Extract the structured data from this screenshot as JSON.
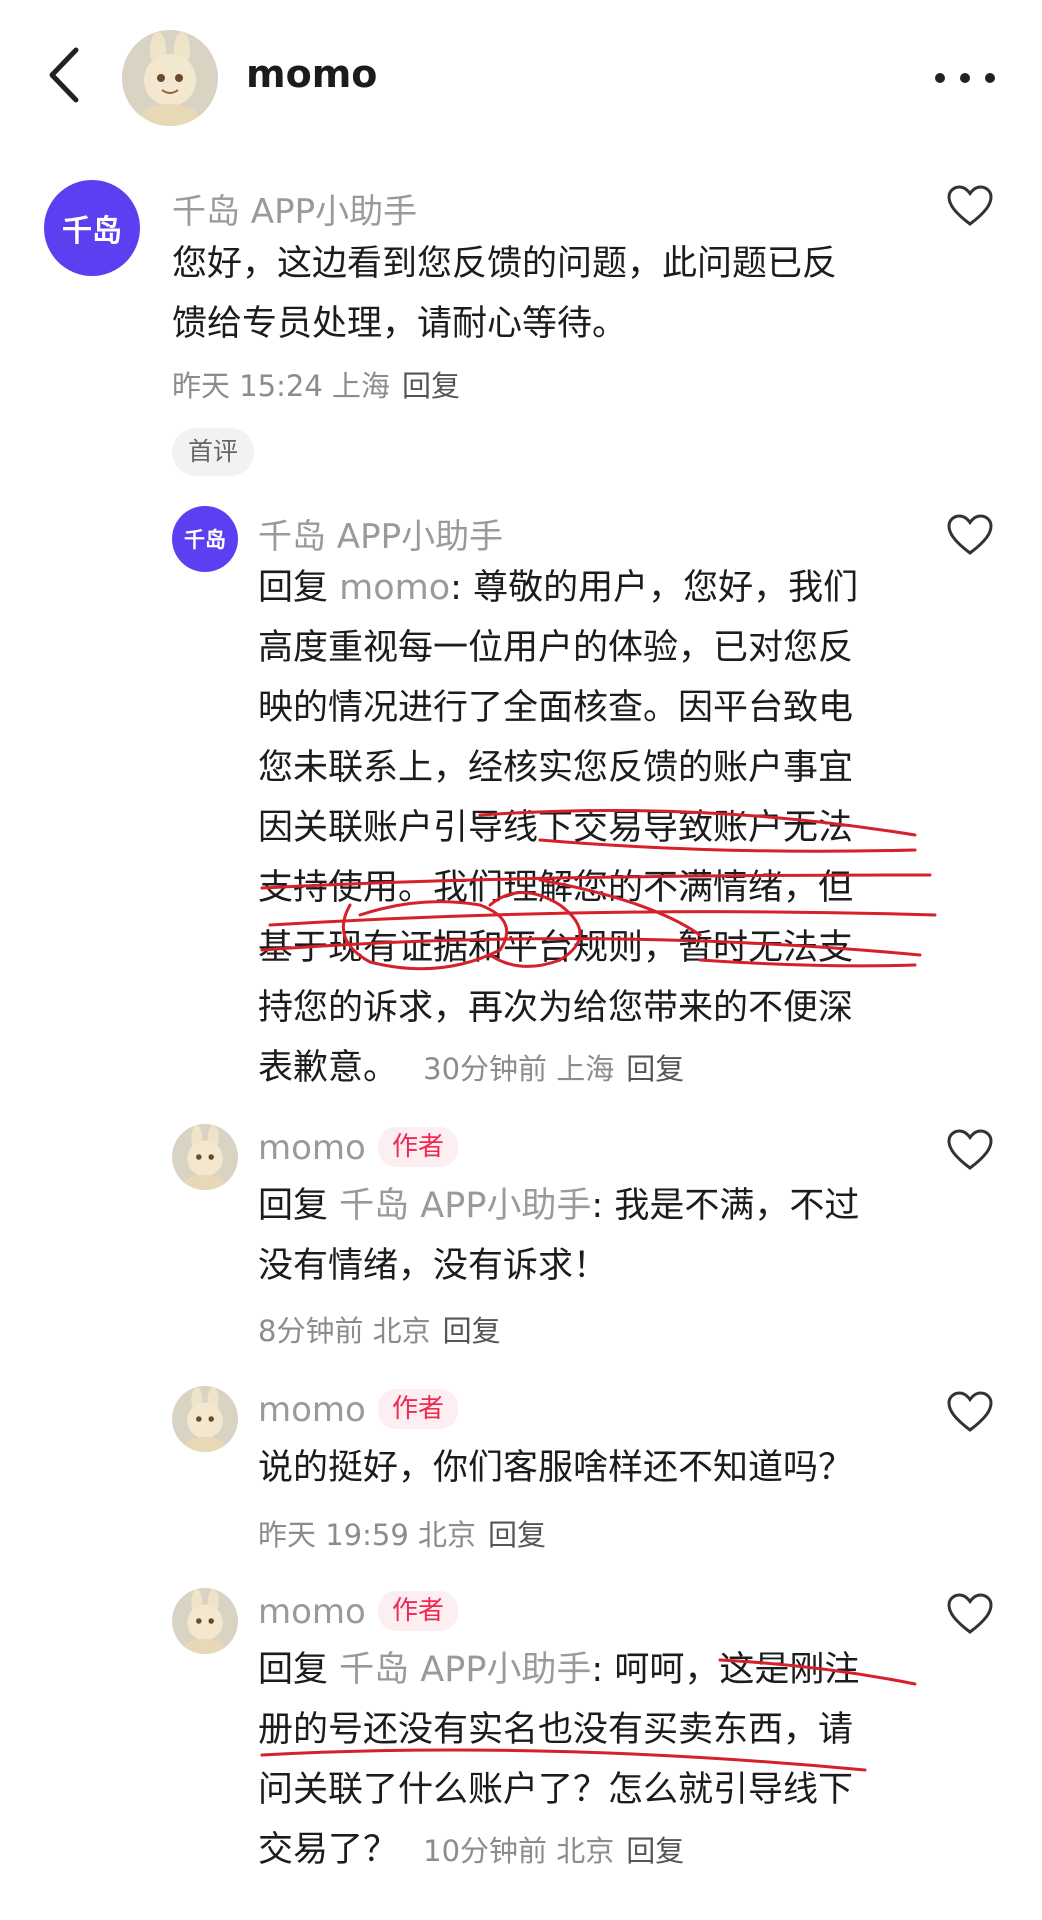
{
  "header": {
    "title": "momo"
  },
  "comments": [
    {
      "nickname": "千岛 APP小助手",
      "text_lines": [
        "您好，这边看到您反馈的问题，此问题已反",
        "馈给专员处理，请耐心等待。"
      ],
      "meta": "昨天 15:24 上海",
      "reply_label": "回复",
      "badge": "首评",
      "avatar_text": "千岛"
    },
    {
      "nickname": "千岛 APP小助手",
      "reply_prefix": "回复 ",
      "reply_target": "momo",
      "first_line_rest": ": 尊敬的用户，您好，我们",
      "text_lines": [
        "高度重视每一位用户的体验，已对您反",
        "映的情况进行了全面核查。因平台致电",
        "您未联系上，经核实您反馈的账户事宜",
        "因关联账户引导线下交易导致账户无法",
        "支持使用。我们理解您的不满情绪，但",
        "基于现有证据和平台规则，暂时无法支",
        "持您的诉求，再次为给您带来的不便深"
      ],
      "last_line": "表歉意。",
      "meta": "30分钟前 上海",
      "reply_label": "回复",
      "avatar_text": "千岛"
    },
    {
      "nickname": "momo",
      "author_badge": "作者",
      "reply_prefix": "回复 ",
      "reply_target": "千岛 APP小助手",
      "first_line_rest": ": 我是不满，不过",
      "text_lines": [
        "没有情绪，没有诉求！"
      ],
      "meta": "8分钟前 北京",
      "reply_label": "回复"
    },
    {
      "nickname": "momo",
      "author_badge": "作者",
      "text_lines": [
        "说的挺好，你们客服啥样还不知道吗？"
      ],
      "meta": "昨天 19:59 北京",
      "reply_label": "回复"
    },
    {
      "nickname": "momo",
      "author_badge": "作者",
      "reply_prefix": "回复 ",
      "reply_target": "千岛 APP小助手",
      "first_line_rest": ": 呵呵，这是刚注",
      "text_lines": [
        "册的号还没有实名也没有买卖东西，请",
        "问关联了什么账户了？怎么就引导线下"
      ],
      "last_line": "交易了？",
      "meta": "10分钟前 北京",
      "reply_label": "回复"
    }
  ],
  "colors": {
    "brand_purple": "#5b3ff0",
    "author_red": "#ee2a52",
    "annotation_red": "#d6202a"
  },
  "icons": [
    "back-arrow-icon",
    "more-dots-icon",
    "heart-icon"
  ]
}
